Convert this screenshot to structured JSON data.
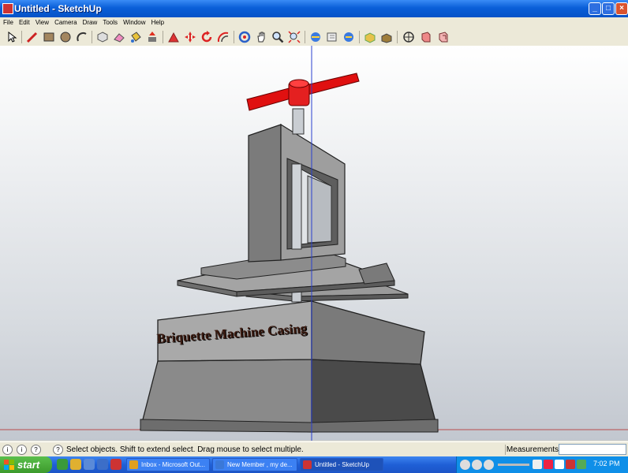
{
  "window": {
    "title": "Untitled - SketchUp"
  },
  "menu": [
    "File",
    "Edit",
    "View",
    "Camera",
    "Draw",
    "Tools",
    "Window",
    "Help"
  ],
  "toolbar_icons": [
    "select-icon",
    "line-icon",
    "rectangle-icon",
    "circle-icon",
    "arc-icon",
    "make-component-icon",
    "eraser-icon",
    "paint-bucket-icon",
    "push-pull-icon",
    "follow-me-icon",
    "move-icon",
    "rotate-icon",
    "offset-icon",
    "orbit-icon",
    "pan-icon",
    "zoom-icon",
    "zoom-extents-icon",
    "previous-view-icon",
    "next-view-icon",
    "standard-views-icon",
    "section-plane-icon",
    "get-models-icon",
    "share-model-icon",
    "component-icon",
    "material-icon"
  ],
  "model": {
    "label": "Briquette Machine Casing"
  },
  "status": {
    "hint": "Select objects. Shift to extend select. Drag mouse to select multiple.",
    "measurements_label": "Measurements",
    "measurements_value": ""
  },
  "taskbar": {
    "start_label": "start",
    "tasks": [
      {
        "label": "Inbox - Microsoft Out...",
        "active": false
      },
      {
        "label": "New Member , my de...",
        "active": false
      },
      {
        "label": "Untitled - SketchUp",
        "active": true
      }
    ],
    "clock": "7:02 PM"
  },
  "colors": {
    "title_bar": "#0a5fd8",
    "handle_red": "#e01010",
    "casing_gray": "#8c8c8c"
  }
}
